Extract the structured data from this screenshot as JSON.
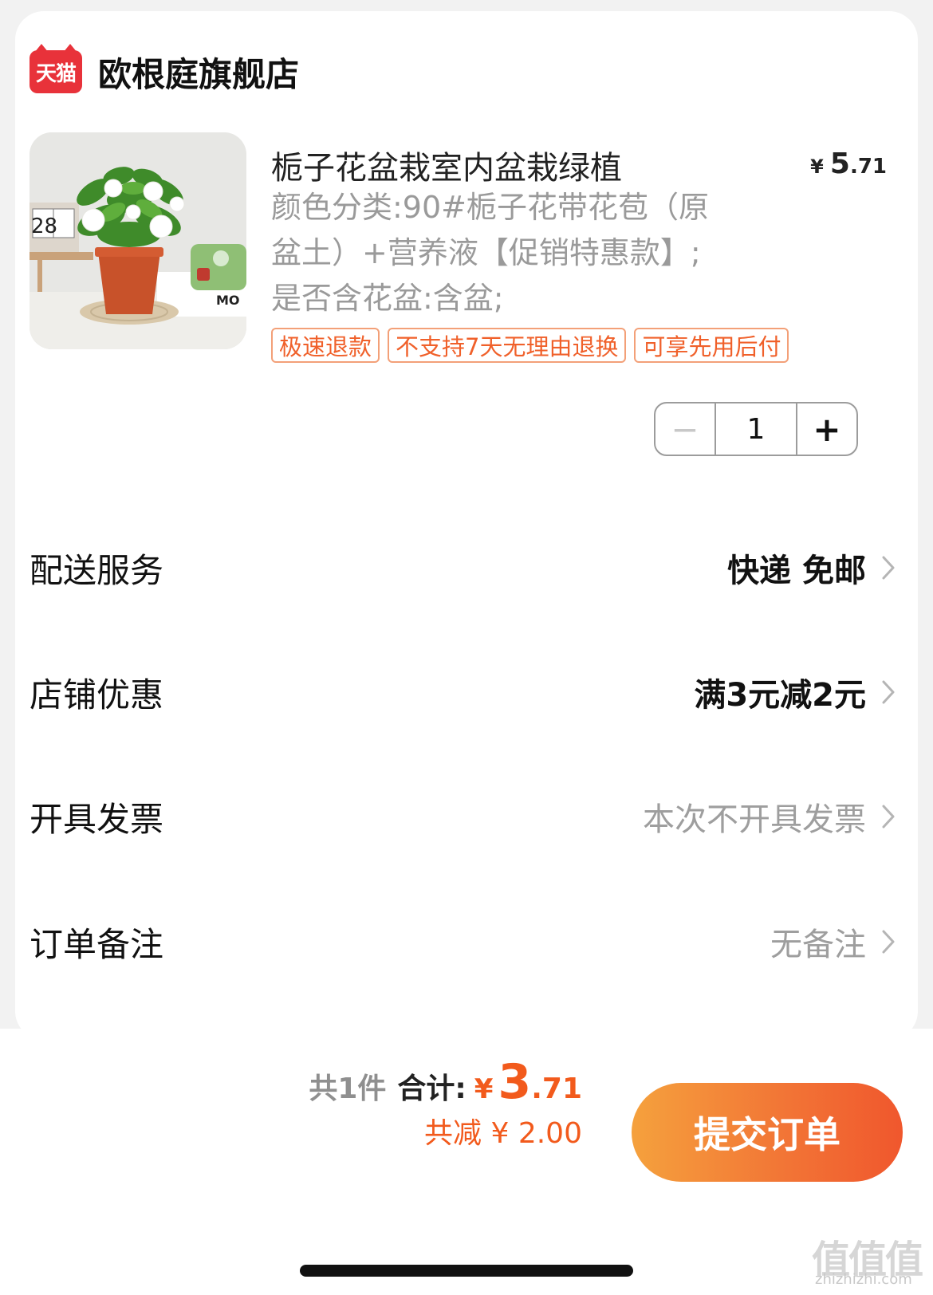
{
  "shop": {
    "platform_badge": "天猫",
    "name": "欧根庭旗舰店"
  },
  "product": {
    "title": "栀子花盆栽室内盆栽绿植",
    "price": {
      "currency": "¥",
      "integer": "5",
      "decimal": ".71"
    },
    "spec": "颜色分类:90#栀子花带花苞（原盆土）+营养液【促销特惠款】;是否含花盆:含盆;",
    "tags": [
      "极速退款",
      "不支持7天无理由退换",
      "可享先用后付"
    ],
    "image_alt": "栀子花盆栽",
    "calendar_digits": "28",
    "radio_text": "MO",
    "quantity": {
      "minus": "−",
      "value": "1",
      "plus": "+"
    }
  },
  "rows": {
    "delivery": {
      "label": "配送服务",
      "value": "快递 免邮"
    },
    "promo": {
      "label": "店铺优惠",
      "value": "满3元减2元"
    },
    "invoice": {
      "label": "开具发票",
      "value": "本次不开具发票"
    },
    "note": {
      "label": "订单备注",
      "value": "无备注"
    }
  },
  "footer": {
    "count_text": "共1件",
    "total_label": "合计:",
    "total_currency": "¥",
    "total_integer": "3",
    "total_decimal": ".71",
    "discount_text": "共减 ¥ 2.00",
    "submit_label": "提交订单"
  },
  "watermark": {
    "main": "值值值",
    "sub": "zhizhizhi.com"
  },
  "colors": {
    "accent": "#f25a1c",
    "tag_border": "#f3a078",
    "tmall_red": "#e8323a",
    "card_bg": "#ffffff",
    "page_bg": "#f2f2f2"
  }
}
